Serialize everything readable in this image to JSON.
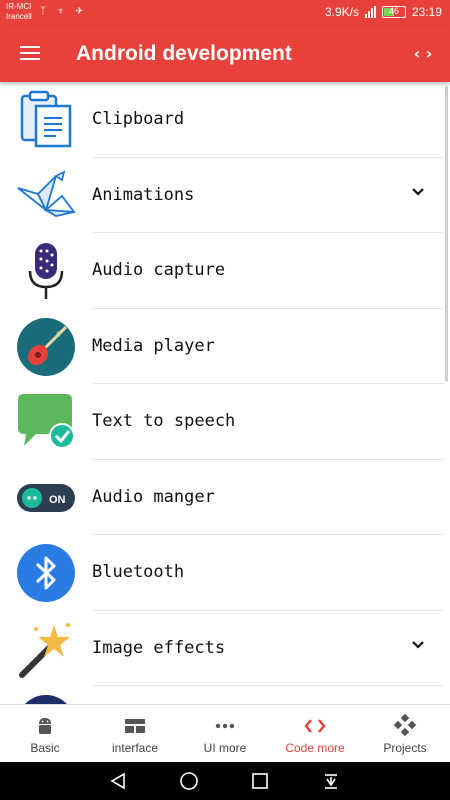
{
  "status_bar": {
    "carrier_line1": "IR-MCI",
    "carrier_line2": "Irancell",
    "left_icons": "ᛉ ♆ ✈",
    "net_speed": "3.9K/s",
    "battery": "46",
    "time": "23:19"
  },
  "app_bar": {
    "title": "Android development",
    "menu_icon": "hamburger-icon",
    "action_icon": "code-icon"
  },
  "list_items": [
    {
      "label": "Clipboard",
      "icon": "clipboard-icon",
      "expandable": false
    },
    {
      "label": "Animations",
      "icon": "origami-bird-icon",
      "expandable": true
    },
    {
      "label": "Audio capture",
      "icon": "microphone-icon",
      "expandable": false
    },
    {
      "label": "Media player",
      "icon": "guitar-icon",
      "expandable": false
    },
    {
      "label": "Text to speech",
      "icon": "speech-bubble-icon",
      "expandable": false
    },
    {
      "label": "Audio manger",
      "icon": "toggle-on-icon",
      "expandable": false
    },
    {
      "label": "Bluetooth",
      "icon": "bluetooth-icon",
      "expandable": false
    },
    {
      "label": "Image effects",
      "icon": "magic-wand-icon",
      "expandable": true
    }
  ],
  "toggle_text": "ON",
  "bottom_nav": [
    {
      "label": "Basic",
      "icon": "android-icon",
      "active": false
    },
    {
      "label": "interface",
      "icon": "layout-icon",
      "active": false
    },
    {
      "label": "UI more",
      "icon": "more-dots-icon",
      "active": false
    },
    {
      "label": "Code more",
      "icon": "code-icon",
      "active": true
    },
    {
      "label": "Projects",
      "icon": "grid-diamond-icon",
      "active": false
    }
  ],
  "colors": {
    "primary": "#e8413b",
    "active_nav": "#e8413b"
  }
}
